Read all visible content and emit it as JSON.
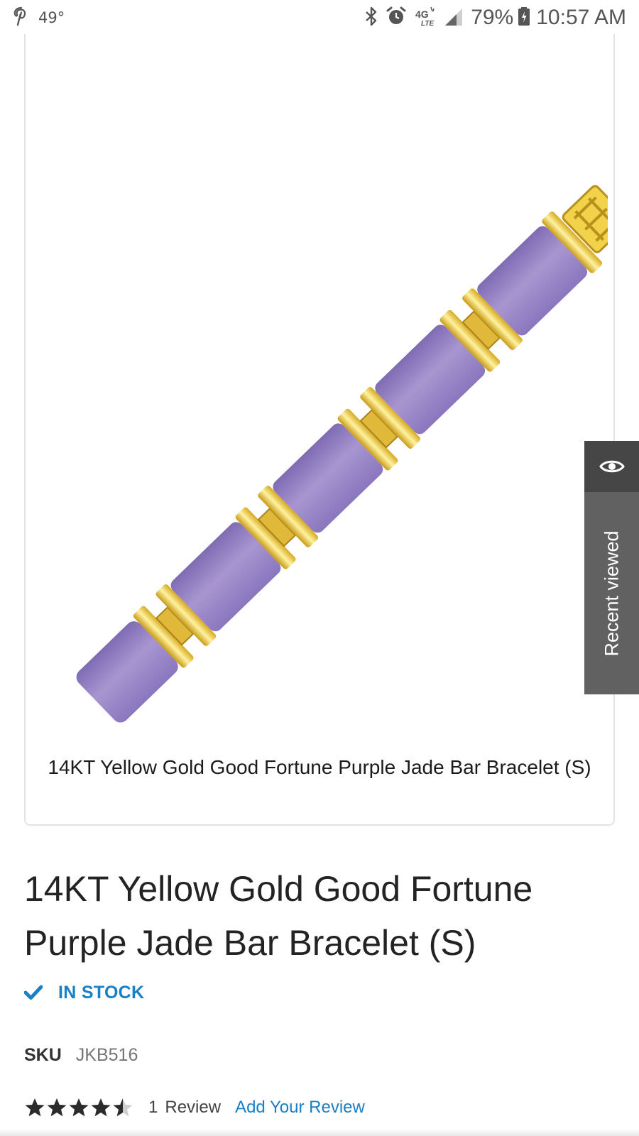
{
  "status_bar": {
    "temperature": "49°",
    "network": "4G",
    "network_sub": "LTE",
    "battery_percent": "79%",
    "time": "10:57 AM",
    "icons": [
      "pinterest-icon",
      "bluetooth-icon",
      "alarm-icon",
      "lte-icon",
      "signal-icon",
      "battery-charging-icon"
    ]
  },
  "product_image": {
    "caption": "14KT Yellow Gold Good Fortune Purple Jade Bar Bracelet (S)",
    "colors": {
      "jade": "#9b86c7",
      "gold": "#e8c23a"
    }
  },
  "recent_viewed": {
    "label": "Recent viewed",
    "icon": "eye-icon"
  },
  "product": {
    "title": "14KT Yellow Gold Good Fortune Purple Jade Bar Bracelet (S)",
    "stock_status": "IN STOCK",
    "sku_label": "SKU",
    "sku_value": "JKB516",
    "rating": 4.5,
    "rating_max": 5,
    "review_count": "1",
    "review_label": "Review",
    "add_review_label": "Add Your Review"
  },
  "colors": {
    "accent_blue": "#1a7fc4",
    "tab_dark": "#464646",
    "tab_mid": "#616161"
  }
}
